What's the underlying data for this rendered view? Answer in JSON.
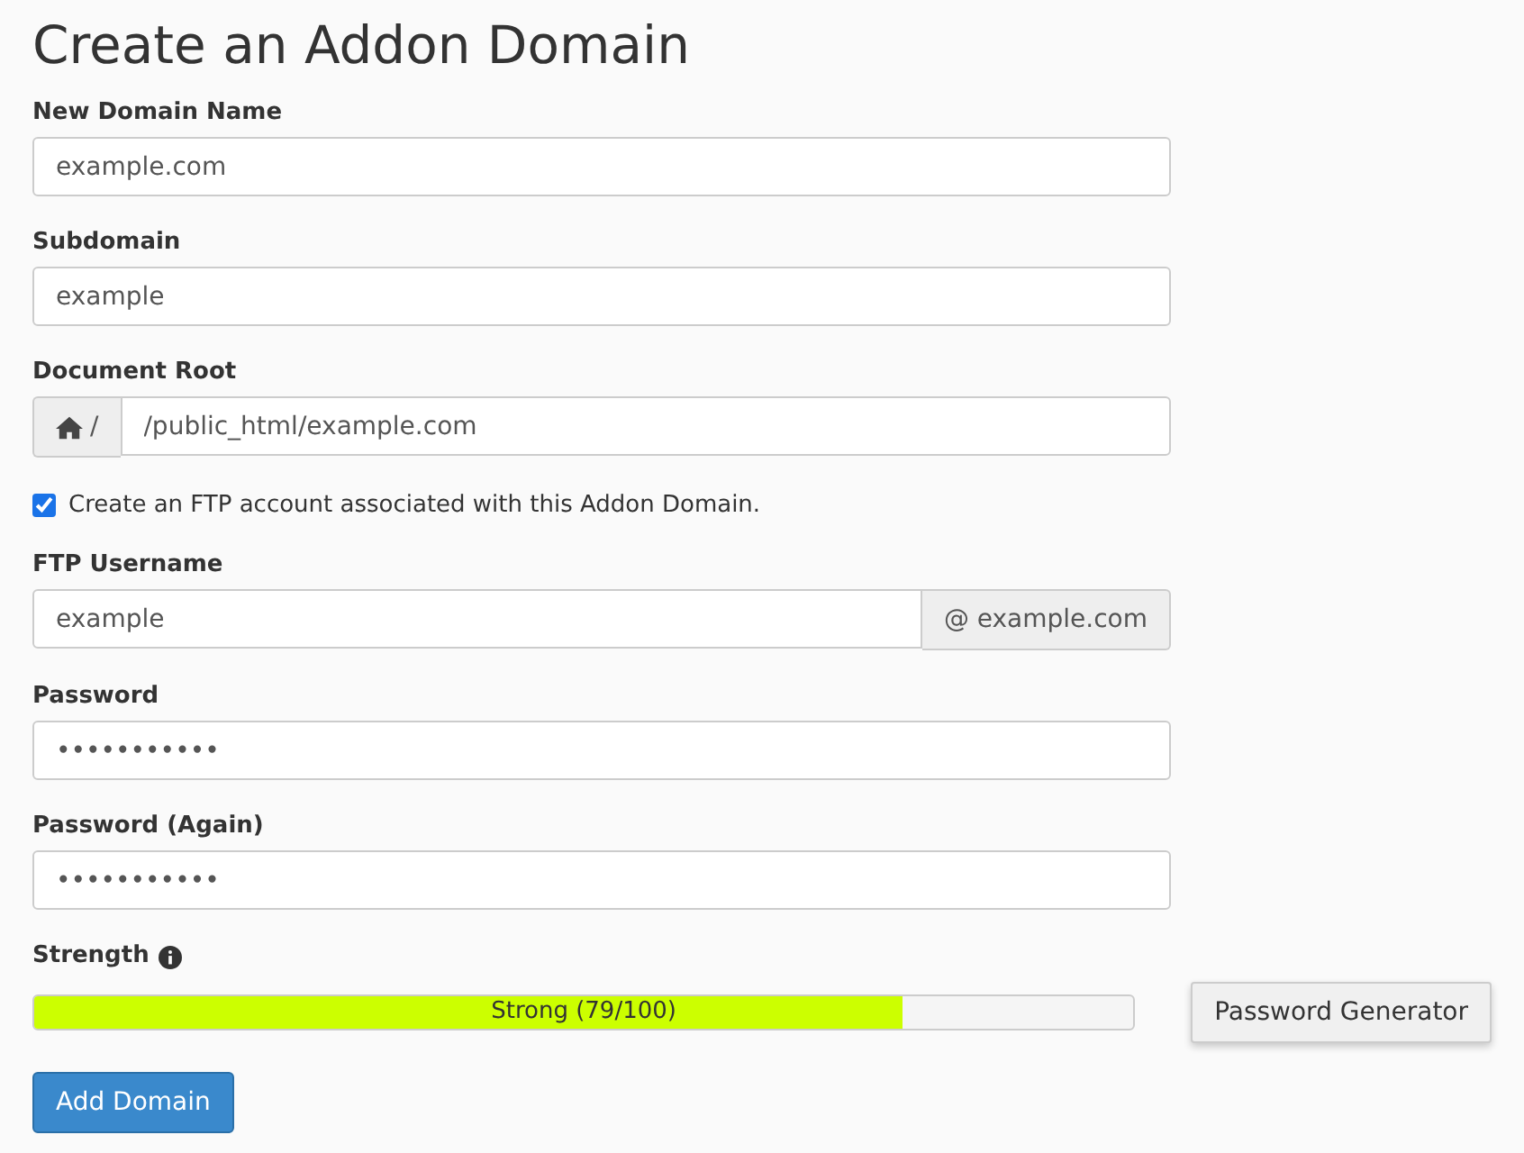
{
  "title": "Create an Addon Domain",
  "fields": [
    {
      "kind": "text",
      "label": "New Domain Name",
      "value": "example.com"
    },
    {
      "kind": "text",
      "label": "Subdomain",
      "value": "example"
    },
    {
      "kind": "prefix",
      "label": "Document Root",
      "addon": "/",
      "value": "/public_html/example.com"
    },
    {
      "kind": "checkbox",
      "label": "Create an FTP account associated with this Addon Domain.",
      "checked": true
    },
    {
      "kind": "suffix",
      "label": "FTP Username",
      "addon": "@ example.com",
      "value": "example"
    },
    {
      "kind": "text",
      "label": "Password",
      "value": "•••••••••••"
    },
    {
      "kind": "text",
      "label": "Password (Again)",
      "value": "•••••••••••"
    }
  ],
  "strength": {
    "label": "Strength",
    "level": 0.79,
    "reading": "Strong (79/100)"
  },
  "generator_button": "Password Generator",
  "submit_button": "Add Domain"
}
